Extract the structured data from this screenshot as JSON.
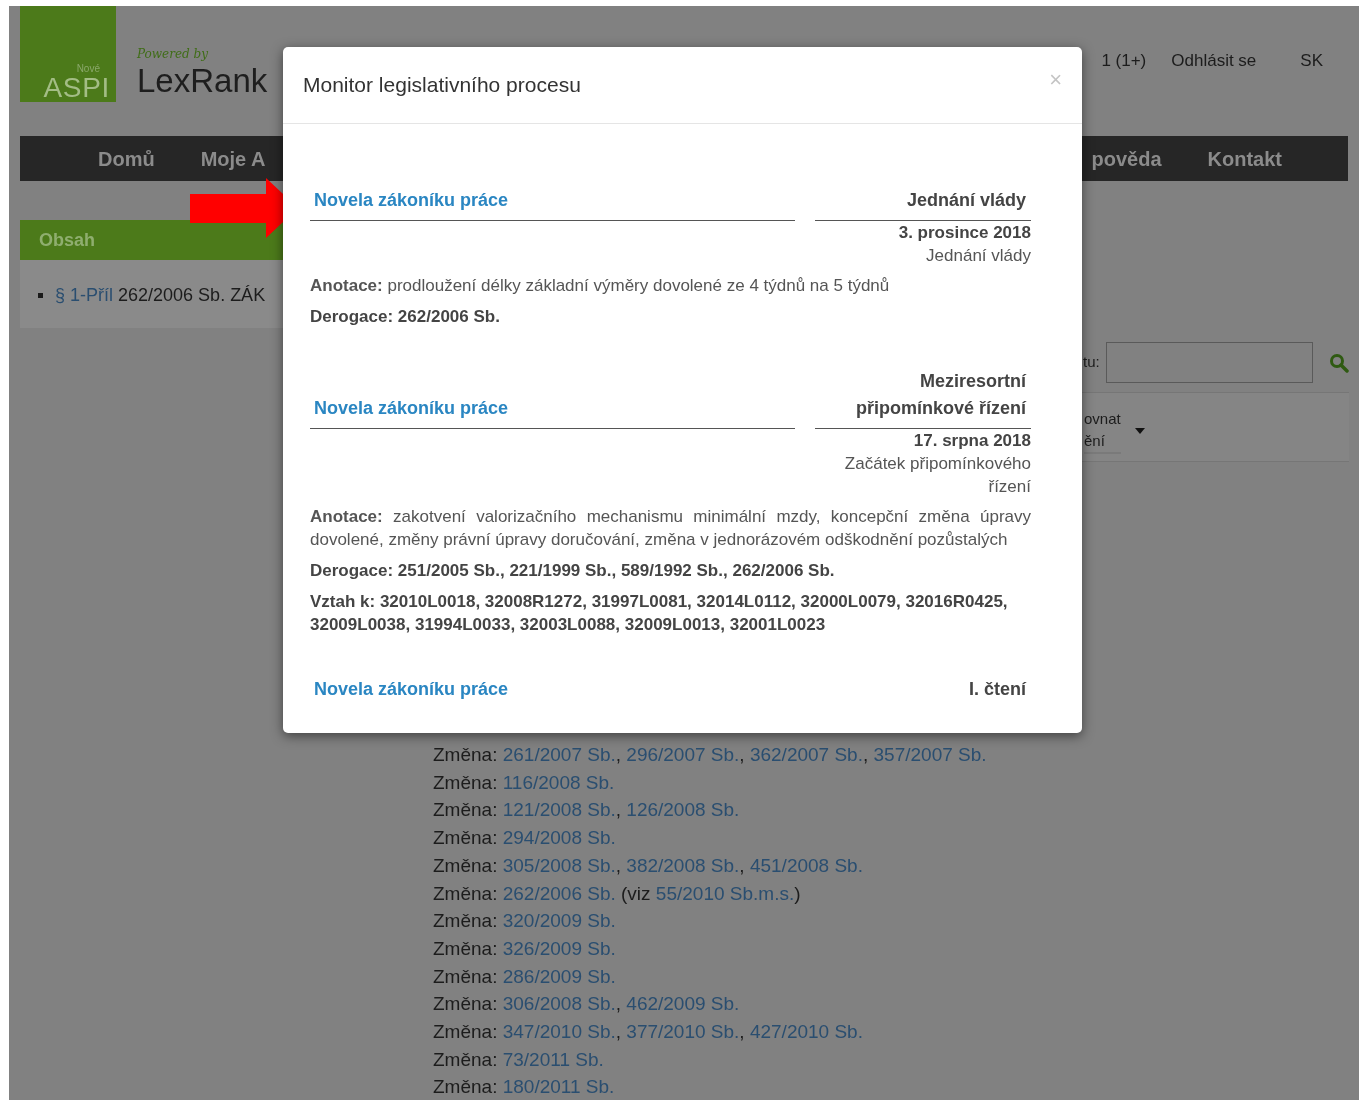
{
  "header": {
    "logo": {
      "small": "Nové",
      "text": "ASPI"
    },
    "powered": "Powered by",
    "brand": "LexRank",
    "user_links": [
      "1 (1+)",
      "Odhlásit se",
      "SK"
    ]
  },
  "nav": [
    "Domů",
    "Moje A",
    "pověda",
    "Kontakt"
  ],
  "sidebar": {
    "title": "Obsah",
    "items": [
      {
        "link": "§ 1-Příl",
        "text": "262/2006 Sb. ZÁK"
      }
    ]
  },
  "search": {
    "label": "tu:"
  },
  "sort": {
    "lines": [
      "ovnat",
      "ění"
    ]
  },
  "changes": [
    [
      {
        "kind": "plain",
        "text": "Změna: "
      },
      {
        "kind": "link",
        "text": "261/2007 Sb."
      },
      {
        "kind": "plain",
        "text": ", "
      },
      {
        "kind": "link",
        "text": "296/2007 Sb."
      },
      {
        "kind": "plain",
        "text": ", "
      },
      {
        "kind": "link",
        "text": "362/2007 Sb."
      },
      {
        "kind": "plain",
        "text": ", "
      },
      {
        "kind": "link",
        "text": "357/2007 Sb."
      }
    ],
    [
      {
        "kind": "plain",
        "text": "Změna: "
      },
      {
        "kind": "link",
        "text": "116/2008 Sb."
      }
    ],
    [
      {
        "kind": "plain",
        "text": "Změna: "
      },
      {
        "kind": "link",
        "text": "121/2008 Sb."
      },
      {
        "kind": "plain",
        "text": ", "
      },
      {
        "kind": "link",
        "text": "126/2008 Sb."
      }
    ],
    [
      {
        "kind": "plain",
        "text": "Změna: "
      },
      {
        "kind": "link",
        "text": "294/2008 Sb."
      }
    ],
    [
      {
        "kind": "plain",
        "text": "Změna: "
      },
      {
        "kind": "link",
        "text": "305/2008 Sb."
      },
      {
        "kind": "plain",
        "text": ", "
      },
      {
        "kind": "link",
        "text": "382/2008 Sb."
      },
      {
        "kind": "plain",
        "text": ", "
      },
      {
        "kind": "link",
        "text": "451/2008 Sb."
      }
    ],
    [
      {
        "kind": "plain",
        "text": "Změna: "
      },
      {
        "kind": "link",
        "text": "262/2006 Sb."
      },
      {
        "kind": "plain",
        "text": " (viz "
      },
      {
        "kind": "link",
        "text": "55/2010 Sb.m.s."
      },
      {
        "kind": "plain",
        "text": ")"
      }
    ],
    [
      {
        "kind": "plain",
        "text": "Změna: "
      },
      {
        "kind": "link",
        "text": "320/2009 Sb."
      }
    ],
    [
      {
        "kind": "plain",
        "text": "Změna: "
      },
      {
        "kind": "link",
        "text": "326/2009 Sb."
      }
    ],
    [
      {
        "kind": "plain",
        "text": "Změna: "
      },
      {
        "kind": "link",
        "text": "286/2009 Sb."
      }
    ],
    [
      {
        "kind": "plain",
        "text": "Změna: "
      },
      {
        "kind": "link",
        "text": "306/2008 Sb."
      },
      {
        "kind": "plain",
        "text": ", "
      },
      {
        "kind": "link",
        "text": "462/2009 Sb."
      }
    ],
    [
      {
        "kind": "plain",
        "text": "Změna: "
      },
      {
        "kind": "link",
        "text": "347/2010 Sb."
      },
      {
        "kind": "plain",
        "text": ", "
      },
      {
        "kind": "link",
        "text": "377/2010 Sb."
      },
      {
        "kind": "plain",
        "text": ", "
      },
      {
        "kind": "link",
        "text": "427/2010 Sb."
      }
    ],
    [
      {
        "kind": "plain",
        "text": "Změna: "
      },
      {
        "kind": "link",
        "text": "73/2011 Sb."
      }
    ],
    [
      {
        "kind": "plain",
        "text": "Změna: "
      },
      {
        "kind": "link",
        "text": "180/2011 Sb."
      }
    ]
  ],
  "modal": {
    "title": "Monitor legislativního procesu",
    "close": "×",
    "entries": [
      {
        "title": "Novela zákoníku práce",
        "stage": "Jednání vlády",
        "date": "3. prosince 2018",
        "event": "Jednání vlády",
        "annotation": "**Anotace:** prodloužení délky základní výměry dovolené ze 4 týdnů na 5 týdnů",
        "derogation": "Derogace: 262/2006 Sb."
      },
      {
        "title": "Novela zákoníku práce",
        "stage": "Meziresortní připomínkové řízení",
        "date": "17. srpna 2018",
        "event": "Začátek připomínkového řízení",
        "annotation": "**Anotace:** zakotvení valorizačního mechanismu minimální mzdy, koncepční změna úpravy dovolené, změny právní úpravy doručování, změna v jednorázovém odškodnění pozůstalých",
        "derogation": "Derogace: 251/2005 Sb., 221/1999 Sb., 589/1992 Sb., 262/2006 Sb.",
        "relation": "Vztah k: 32010L0018, 32008R1272, 31997L0081, 32014L0112, 32000L0079, 32016R0425, 32009L0038, 31994L0033, 32003L0088, 32009L0013, 32001L0023"
      },
      {
        "title": "Novela zákoníku práce",
        "stage": "I. čtení"
      }
    ]
  }
}
